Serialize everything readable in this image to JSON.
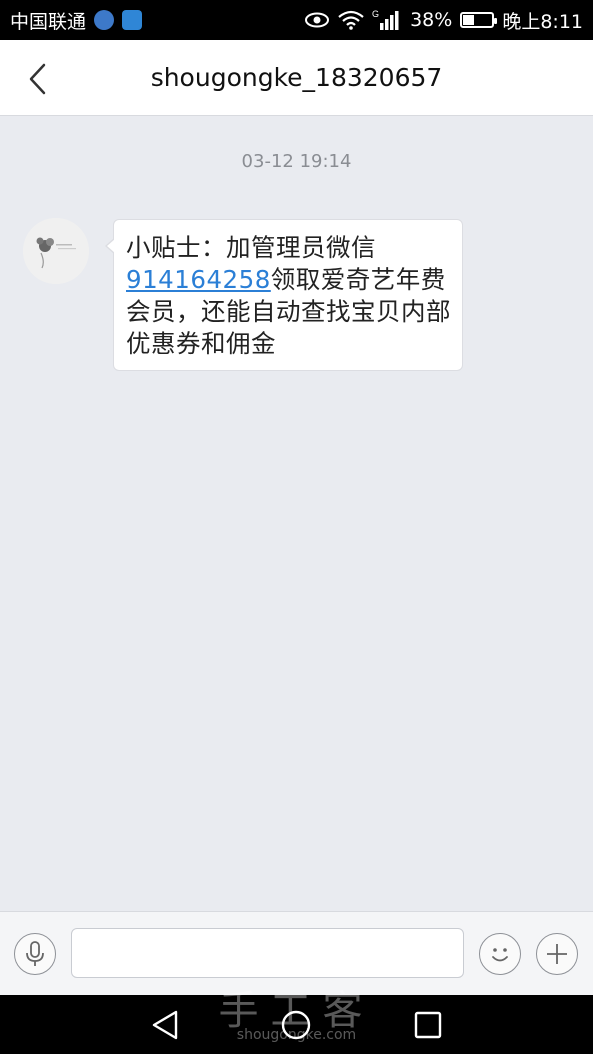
{
  "status_bar": {
    "carrier": "中国联通",
    "battery": "38%",
    "battery_level": 0.38,
    "network": "G",
    "time": "晚上8:11"
  },
  "header": {
    "title": "shougongke_18320657"
  },
  "chat": {
    "timestamp": "03-12 19:14",
    "message": {
      "prefix": "小贴士：加管理员微信",
      "link": "914164258",
      "suffix": "领取爱奇艺年费会员，还能自动查找宝贝内部优惠券和佣金"
    }
  },
  "input_bar": {
    "placeholder": "",
    "voice_icon": "microphone-icon",
    "emoji_icon": "smiley-icon",
    "add_icon": "plus-icon"
  },
  "watermark": {
    "text": "手工客",
    "sub": "shougongke.com"
  },
  "colors": {
    "link": "#2b7fd6",
    "background": "#e9ebf0"
  }
}
